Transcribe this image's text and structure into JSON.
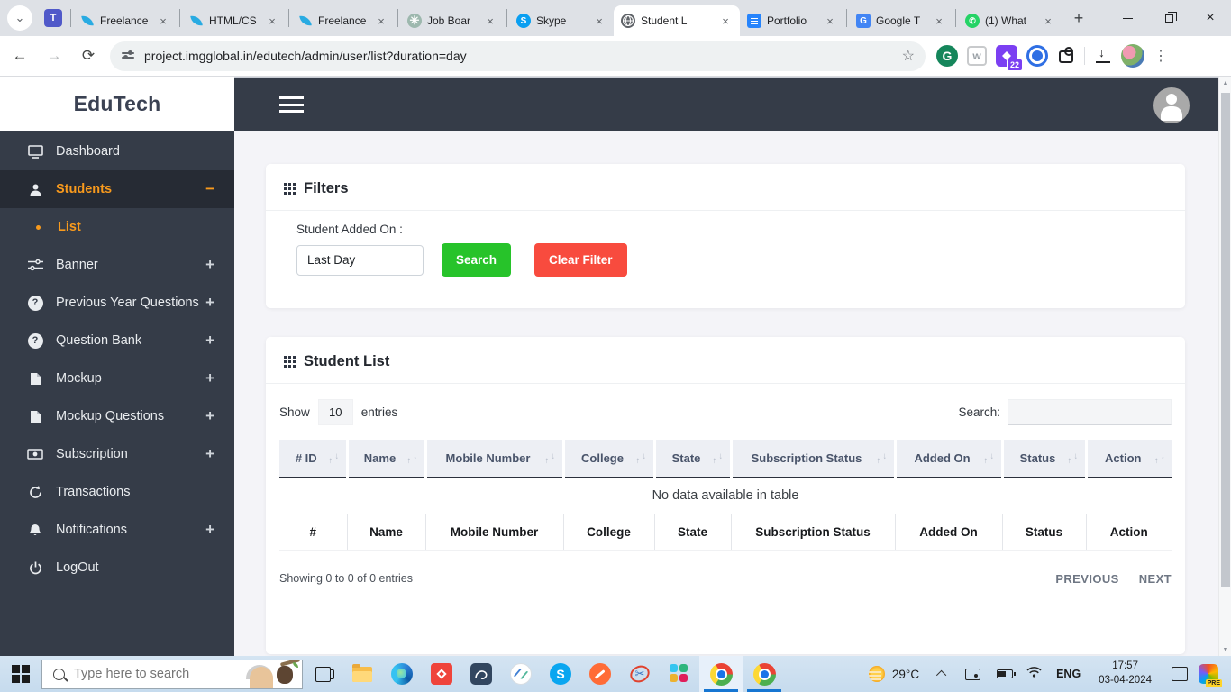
{
  "browser": {
    "tabs": [
      {
        "title": "Freelance",
        "icon": "freelancer"
      },
      {
        "title": "HTML/CS",
        "icon": "freelancer"
      },
      {
        "title": "Freelance",
        "icon": "freelancer"
      },
      {
        "title": "Job Boar",
        "icon": "chatgpt"
      },
      {
        "title": "Skype",
        "icon": "skype"
      },
      {
        "title": "Student L",
        "icon": "globe",
        "active": true
      },
      {
        "title": "Portfolio",
        "icon": "google-docs"
      },
      {
        "title": "Google T",
        "icon": "google-translate"
      },
      {
        "title": "(1) What",
        "icon": "whatsapp"
      }
    ],
    "url": "project.imgglobal.in/edutech/admin/user/list?duration=day",
    "extension_badge": "22"
  },
  "icons": {
    "tab_search": "⌄",
    "close_tab": "×",
    "new_tab": "+",
    "back": "←",
    "forward": "→",
    "reload": "⟳",
    "star": "☆",
    "kebab": "⋮",
    "grammarly_letter": "G",
    "wayback_letter": "w",
    "teams_letter": "T",
    "chatgpt_glyph": "✳",
    "skype_letter": "S",
    "translate_letter": "G",
    "whatsapp_glyph": "✆",
    "question_mark": "?",
    "sort_up": "↑",
    "sort_down": "↓",
    "scroll_up": "▲",
    "scroll_down": "▼",
    "pg_glyph": "ϟ",
    "scissors": "✂",
    "close_window": "×"
  },
  "app": {
    "brand": "EduTech",
    "sidebar": [
      {
        "label": "Dashboard",
        "icon": "monitor",
        "toggle": ""
      },
      {
        "label": "Students",
        "icon": "user",
        "toggle": "−"
      },
      {
        "label": "List",
        "icon": "dot",
        "toggle": ""
      },
      {
        "label": "Banner",
        "icon": "sliders",
        "toggle": "+"
      },
      {
        "label": "Previous Year Questions",
        "icon": "help-circle",
        "toggle": "+"
      },
      {
        "label": "Question Bank",
        "icon": "help-circle",
        "toggle": "+"
      },
      {
        "label": "Mockup",
        "icon": "file",
        "toggle": "+"
      },
      {
        "label": "Mockup Questions",
        "icon": "file",
        "toggle": "+"
      },
      {
        "label": "Subscription",
        "icon": "money",
        "toggle": "+"
      },
      {
        "label": "Transactions",
        "icon": "history",
        "toggle": ""
      },
      {
        "label": "Notifications",
        "icon": "bell",
        "toggle": "+"
      },
      {
        "label": "LogOut",
        "icon": "power",
        "toggle": ""
      }
    ],
    "filters": {
      "title": "Filters",
      "field_label": "Student Added On :",
      "field_value": "Last Day",
      "search_button": "Search",
      "clear_button": "Clear Filter"
    },
    "student_list": {
      "title": "Student List",
      "show_label": "Show",
      "page_size": "10",
      "entries_label": "entries",
      "search_label": "Search:",
      "columns": [
        "# ID",
        "Name",
        "Mobile Number",
        "College",
        "State",
        "Subscription Status",
        "Added On",
        "Status",
        "Action"
      ],
      "footer_columns": [
        "#",
        "Name",
        "Mobile Number",
        "College",
        "State",
        "Subscription Status",
        "Added On",
        "Status",
        "Action"
      ],
      "empty_message": "No data available in table",
      "info": "Showing 0 to 0 of 0 entries",
      "prev_label": "PREVIOUS",
      "next_label": "NEXT"
    }
  },
  "taskbar": {
    "search_placeholder": "Type here to search",
    "weather_temp": "29°C",
    "language": "ENG",
    "time": "17:57",
    "date": "03-04-2024",
    "copilot_badge": "PRE"
  }
}
